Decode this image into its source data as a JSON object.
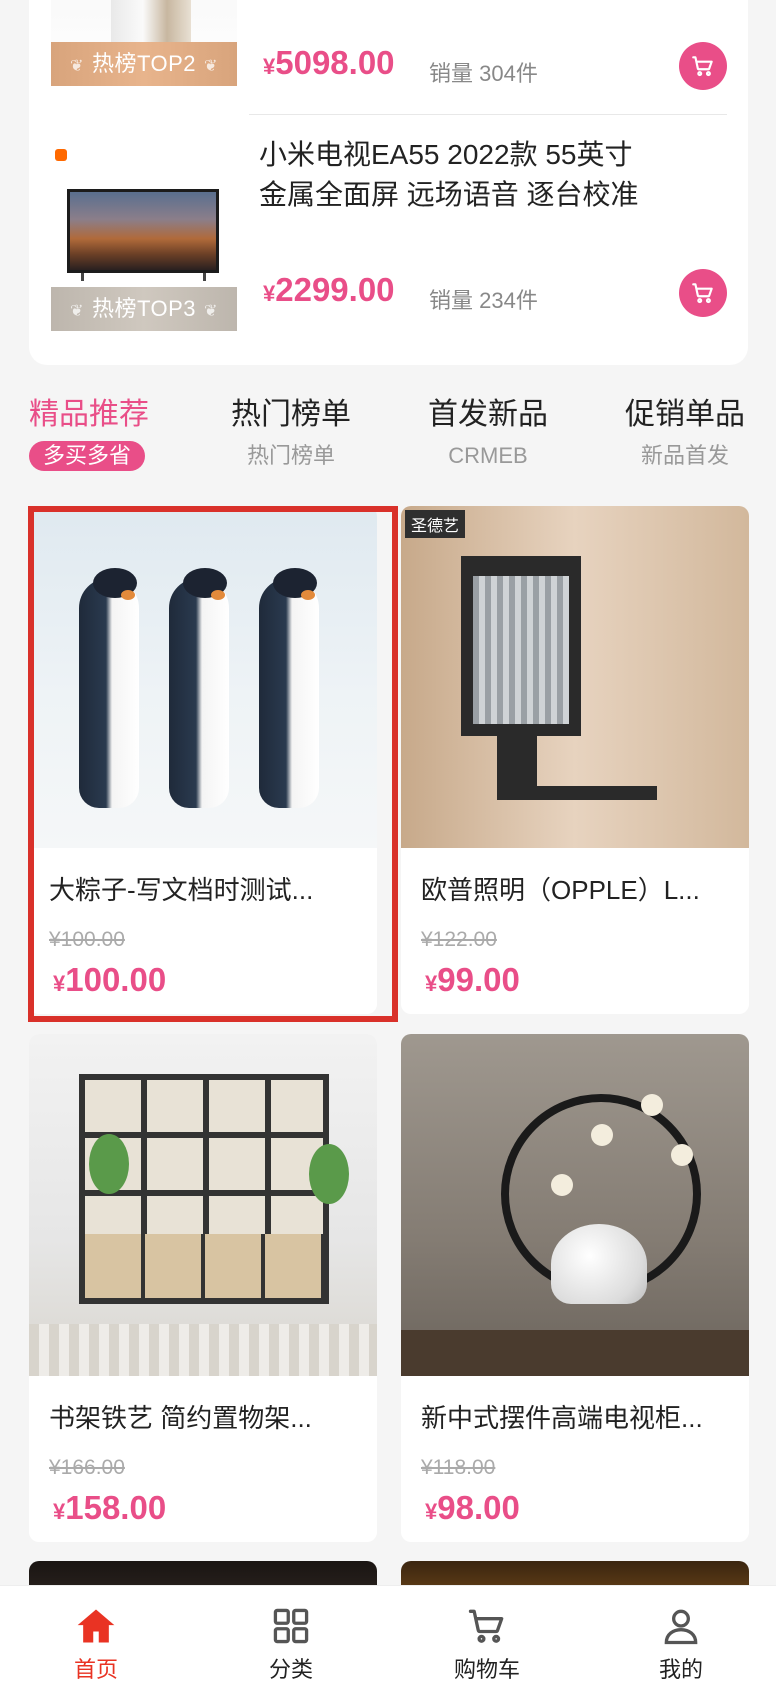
{
  "ranking": {
    "items": [
      {
        "badge": "热榜TOP2",
        "price_symbol": "¥",
        "price": "5098.00",
        "sales_label": "销量",
        "sales": "304件"
      },
      {
        "title_line1": "小米电视EA55 2022款 55英寸",
        "title_line2": "金属全面屏 远场语音 逐台校准",
        "badge": "热榜TOP3",
        "price_symbol": "¥",
        "price": "2299.00",
        "sales_label": "销量",
        "sales": "234件"
      }
    ]
  },
  "tabs": [
    {
      "title": "精品推荐",
      "subtitle": "多买多省",
      "active": true
    },
    {
      "title": "热门榜单",
      "subtitle": "热门榜单"
    },
    {
      "title": "首发新品",
      "subtitle": "CRMEB"
    },
    {
      "title": "促销单品",
      "subtitle": "新品首发"
    }
  ],
  "products": [
    {
      "name": "大粽子-写文档时测试...",
      "original_price": "¥100.00",
      "price_symbol": "¥",
      "price": "100.00",
      "brand": ""
    },
    {
      "name": "欧普照明（OPPLE）L...",
      "original_price": "¥122.00",
      "price_symbol": "¥",
      "price": "99.00",
      "brand": "圣德艺"
    },
    {
      "name": "书架铁艺 简约置物架...",
      "original_price": "¥166.00",
      "price_symbol": "¥",
      "price": "158.00"
    },
    {
      "name": "新中式摆件高端电视柜...",
      "original_price": "¥118.00",
      "price_symbol": "¥",
      "price": "98.00"
    }
  ],
  "bottom_nav": [
    {
      "label": "首页",
      "icon": "home-icon",
      "active": true
    },
    {
      "label": "分类",
      "icon": "category-grid-icon"
    },
    {
      "label": "购物车",
      "icon": "cart-icon"
    },
    {
      "label": "我的",
      "icon": "user-icon"
    }
  ],
  "colors": {
    "accent": "#e94e88",
    "nav_active": "#e93323",
    "selection_outline": "#d9312a"
  }
}
